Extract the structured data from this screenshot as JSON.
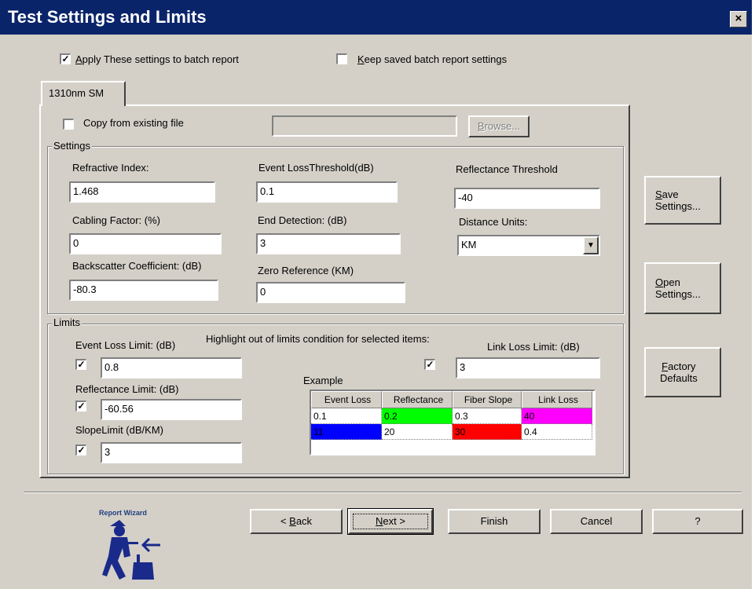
{
  "window": {
    "title": "Test Settings and Limits",
    "close_label": "×"
  },
  "options": {
    "apply_batch": {
      "label_accel": "A",
      "label_rest": "pply These settings to batch report",
      "checked": true
    },
    "keep_saved": {
      "label_accel": "K",
      "label_rest": "eep saved batch report settings",
      "checked": false
    }
  },
  "tabs": [
    {
      "label": "1310nm SM",
      "active": true
    }
  ],
  "copy": {
    "label": "Copy from existing file",
    "checked": false,
    "path_value": "",
    "browse_accel": "B",
    "browse_rest": "rowse..."
  },
  "settings": {
    "group_label": "Settings",
    "refractive_index": {
      "label": "Refractive Index:",
      "value": "1.468"
    },
    "cabling_factor": {
      "label": "Cabling Factor: (%)",
      "value": "0"
    },
    "backscatter": {
      "label": "Backscatter Coefficient: (dB)",
      "value": "-80.3"
    },
    "event_loss_threshold": {
      "label": "Event LossThreshold(dB)",
      "value": "0.1"
    },
    "end_detection": {
      "label": "End Detection: (dB)",
      "value": "3"
    },
    "zero_reference": {
      "label": "Zero Reference (KM)",
      "value": "0"
    },
    "reflectance_threshold": {
      "label": "Reflectance Threshold",
      "value": "-40"
    },
    "distance_units": {
      "label": "Distance Units:",
      "value": "KM"
    }
  },
  "limits": {
    "group_label": "Limits",
    "highlight_label": "Highlight out of limits condition for selected items:",
    "event_loss": {
      "label": "Event Loss Limit: (dB)",
      "value": "0.8",
      "checked": true
    },
    "reflectance": {
      "label": "Reflectance Limit: (dB)",
      "value": "-60.56",
      "checked": true
    },
    "slope": {
      "label": "SlopeLimit (dB/KM)",
      "value": "3",
      "checked": true
    },
    "link_loss": {
      "label": "Link Loss Limit: (dB)",
      "value": "3",
      "checked": true
    },
    "example": {
      "label": "Example",
      "headers": [
        "Event Loss",
        "Reflectance",
        "Fiber Slope",
        "Link Loss"
      ],
      "rows": [
        [
          {
            "text": "0.1",
            "bg": "#ffffff"
          },
          {
            "text": "0.2",
            "bg": "#00ff00"
          },
          {
            "text": "0.3",
            "bg": "#ffffff"
          },
          {
            "text": "40",
            "bg": "#ff00ff"
          }
        ],
        [
          {
            "text": "11",
            "bg": "#0000ff"
          },
          {
            "text": "20",
            "bg": "#ffffff"
          },
          {
            "text": "30",
            "bg": "#ff0000"
          },
          {
            "text": "0.4",
            "bg": "#ffffff"
          }
        ]
      ]
    }
  },
  "side_buttons": {
    "save": {
      "accel": "S",
      "rest": "ave",
      "line2": "Settings..."
    },
    "open": {
      "accel": "O",
      "rest": "pen",
      "line2": "Settings..."
    },
    "factory": {
      "accel": "F",
      "rest": "actory",
      "line2": "Defaults"
    }
  },
  "wizard": {
    "logo_label": "Report Wizard"
  },
  "footer": {
    "back": {
      "prefix": "< ",
      "accel": "B",
      "rest": "ack"
    },
    "next": {
      "accel": "N",
      "rest": "ext >"
    },
    "finish": "Finish",
    "cancel": "Cancel",
    "help": "?"
  },
  "colors": {
    "titlebar": "#0a246a",
    "face": "#d4d0c8"
  }
}
